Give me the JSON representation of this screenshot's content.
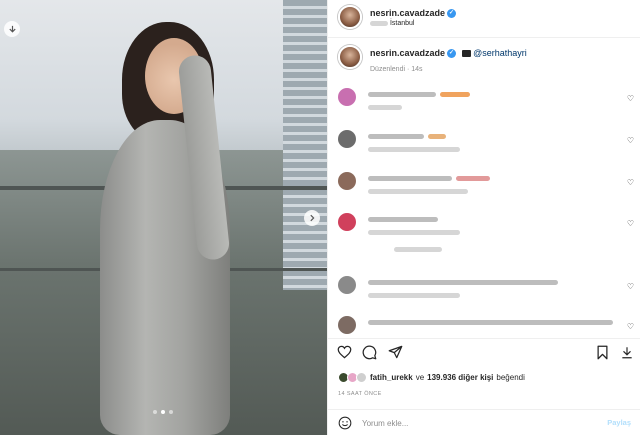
{
  "header": {
    "username": "nesrin.cavadzade",
    "location": "İstanbul"
  },
  "caption": {
    "username": "nesrin.cavadzade",
    "mention": "@serhathayri",
    "meta": "Düzenlendi · 14s"
  },
  "comments": [
    {
      "avatar_color": "#c86fb0"
    },
    {
      "avatar_color": "#6c6c6c"
    },
    {
      "avatar_color": "#8b6a5b"
    },
    {
      "avatar_color": "#d0405c"
    },
    {
      "avatar_color": "#8a8a8a"
    },
    {
      "avatar_color": "#7d6b63"
    }
  ],
  "likes": {
    "first_user": "fatih_urekk",
    "connector": "ve",
    "count_text": "139.936 diğer kişi",
    "suffix": "beğendi"
  },
  "timestamp": "14 SAAT ÖNCE",
  "comment_box": {
    "placeholder": "Yorum ekle...",
    "post_label": "Paylaş"
  },
  "carousel": {
    "current": 2,
    "total": 3
  },
  "icons": {
    "download": "download-icon",
    "next": "chevron-right-icon",
    "heart": "heart-icon",
    "comment": "comment-icon",
    "share": "share-icon",
    "save": "bookmark-icon",
    "emoji": "emoji-icon"
  },
  "colors": {
    "verified": "#3897f0",
    "mention": "#00376b",
    "post_button_disabled": "#b2dffc"
  }
}
